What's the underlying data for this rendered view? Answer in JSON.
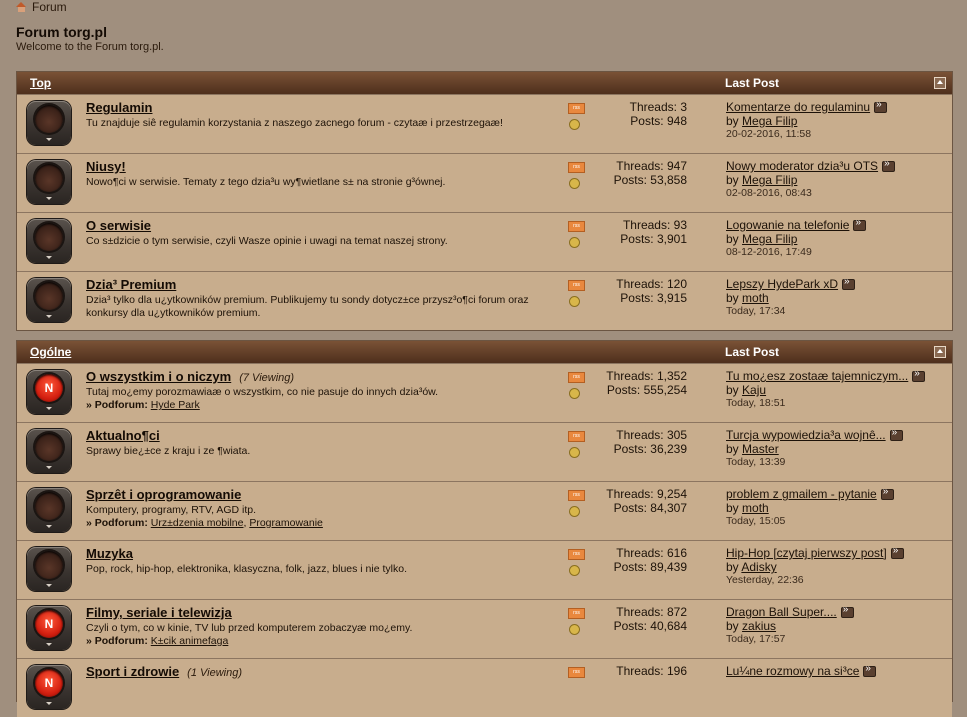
{
  "breadcrumb": "Forum",
  "header": {
    "title": "Forum torg.pl",
    "welcome": "Welcome to the Forum torg.pl."
  },
  "labels": {
    "threads": "Threads:",
    "posts": "Posts:",
    "by": "by",
    "subforum": "» Podforum:"
  },
  "sections": [
    {
      "title": "Top",
      "last_post_header": "Last Post",
      "forums": [
        {
          "name": "Regulamin",
          "desc": "Tu znajduje siê regulamin korzystania z naszego zacnego forum - czytaæ i przestrzegaæ!",
          "viewing": "",
          "threads": "3",
          "posts": "948",
          "last_title": "Komentarze do regulaminu",
          "last_by": "Mega Filip",
          "last_date": "20-02-2016,",
          "last_time": "11:58"
        },
        {
          "name": "Niusy!",
          "desc": "Nowo¶ci w serwisie. Tematy z tego dzia³u wy¶wietlane s± na stronie g³ównej.",
          "viewing": "",
          "threads": "947",
          "posts": "53,858",
          "last_title": "Nowy moderator dzia³u OTS",
          "last_by": "Mega Filip",
          "last_date": "02-08-2016,",
          "last_time": "08:43"
        },
        {
          "name": "O serwisie",
          "desc": "Co s±dzicie o tym serwisie, czyli Wasze opinie i uwagi na temat naszej strony.",
          "viewing": "",
          "threads": "93",
          "posts": "3,901",
          "last_title": "Logowanie na telefonie",
          "last_by": "Mega Filip",
          "last_date": "08-12-2016,",
          "last_time": "17:49"
        },
        {
          "name": "Dzia³ Premium",
          "desc": "Dzia³ tylko dla u¿ytkowników premium. Publikujemy tu sondy dotycz±ce przysz³o¶ci forum oraz konkursy dla u¿ytkowników premium.",
          "viewing": "",
          "threads": "120",
          "posts": "3,915",
          "last_title": "Lepszy HydePark xD",
          "last_by": "moth",
          "last_date": "Today,",
          "last_time": "17:34"
        }
      ]
    },
    {
      "title": "Ogólne",
      "last_post_header": "Last Post",
      "forums": [
        {
          "name": "O wszystkim i o niczym",
          "viewing": "(7 Viewing)",
          "desc": "Tutaj mo¿emy porozmawiaæ o wszystkim, co nie pasuje do innych dzia³ów.",
          "subforums": "Hyde Park",
          "threads": "1,352",
          "posts": "555,254",
          "last_title": "Tu mo¿esz zostaæ tajemniczym...",
          "last_by": "Kaju",
          "last_date": "Today,",
          "last_time": "18:51"
        },
        {
          "name": "Aktualno¶ci",
          "viewing": "",
          "desc": "Sprawy bie¿±ce z kraju i ze ¶wiata.",
          "threads": "305",
          "posts": "36,239",
          "last_title": "Turcja wypowiedzia³a wojnê...",
          "last_by": "Master",
          "last_date": "Today,",
          "last_time": "13:39"
        },
        {
          "name": "Sprzêt i oprogramowanie",
          "viewing": "",
          "desc": "Komputery, programy, RTV, AGD itp.",
          "subforums_a": "Urz±dzenia mobilne",
          "subforums_b": "Programowanie",
          "threads": "9,254",
          "posts": "84,307",
          "last_title": "problem z gmailem - pytanie",
          "last_by": "moth",
          "last_date": "Today,",
          "last_time": "15:05"
        },
        {
          "name": "Muzyka",
          "viewing": "",
          "desc": "Pop, rock, hip-hop, elektronika, klasyczna, folk, jazz, blues i nie tylko.",
          "threads": "616",
          "posts": "89,439",
          "last_title": "Hip-Hop [czytaj pierwszy post]",
          "last_by": "Adisky",
          "last_date": "Yesterday,",
          "last_time": "22:36"
        },
        {
          "name": "Filmy, seriale i telewizja",
          "viewing": "",
          "desc": "Czyli o tym, co w kinie, TV lub przed komputerem zobaczyæ mo¿emy.",
          "subforums": "K±cik animefaga",
          "threads": "872",
          "posts": "40,684",
          "last_title": "Dragon Ball Super....",
          "last_by": "zakius",
          "last_date": "Today,",
          "last_time": "17:57"
        },
        {
          "name": "Sport i zdrowie",
          "viewing": "(1 Viewing)",
          "threads": "196",
          "last_title": "Lu¼ne rozmowy na si³ce"
        }
      ]
    }
  ]
}
